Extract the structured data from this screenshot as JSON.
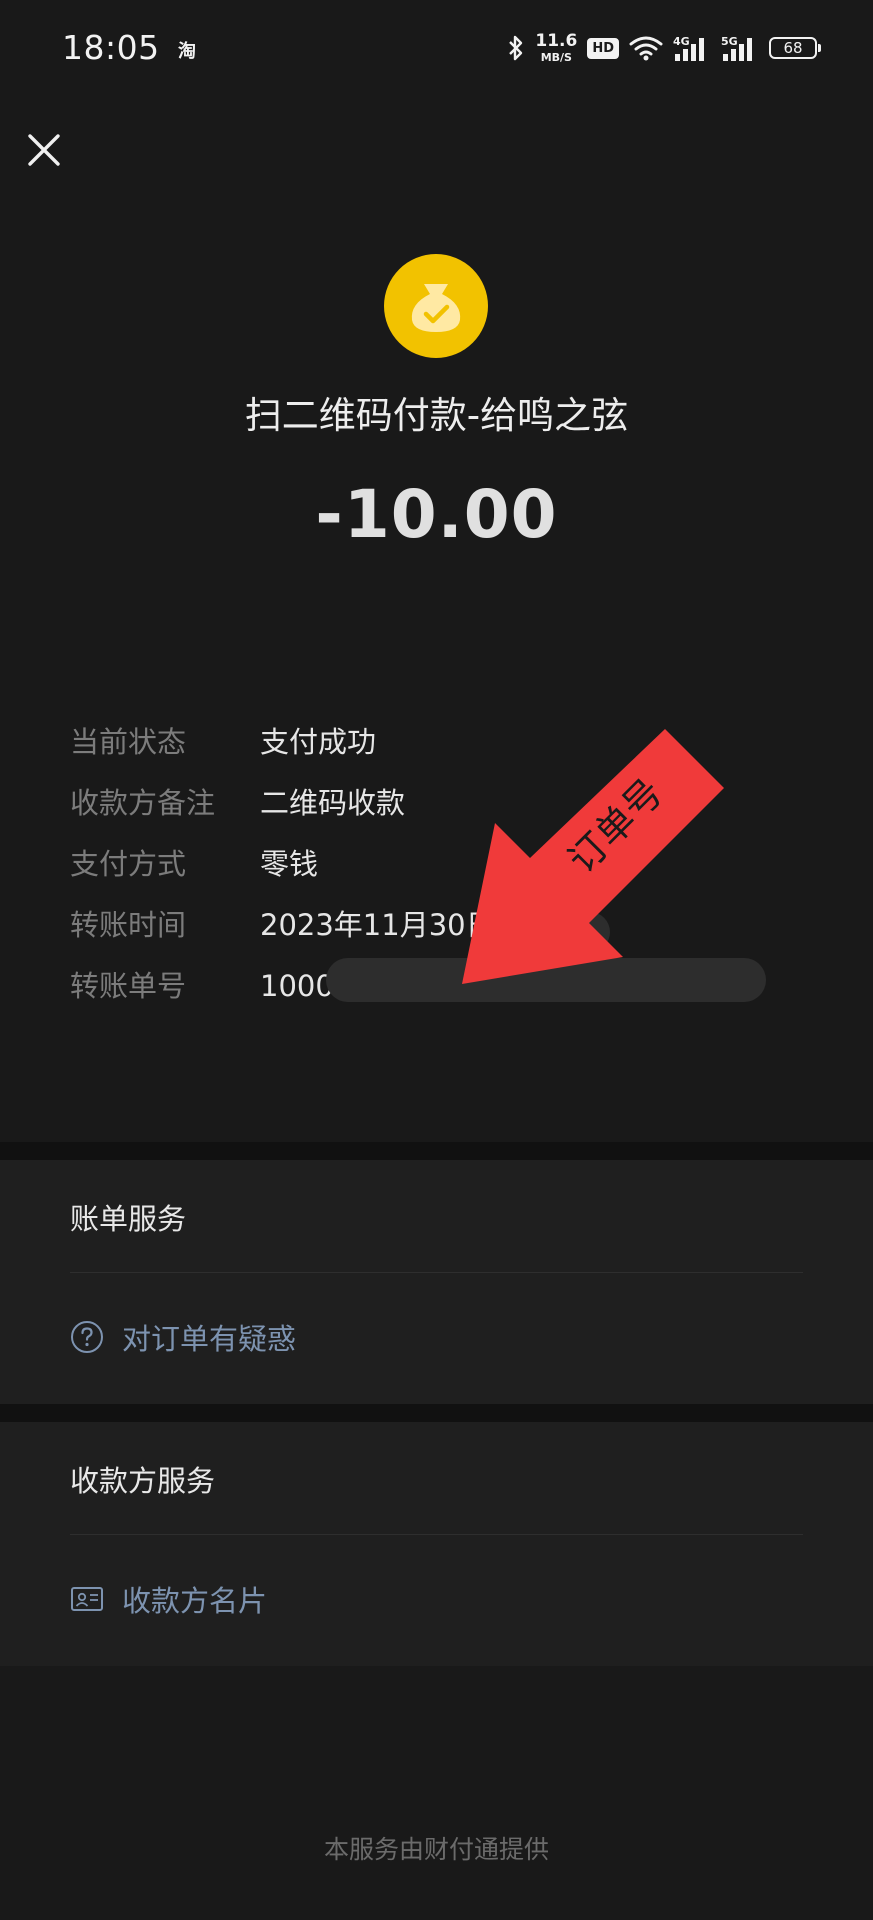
{
  "status_bar": {
    "time": "18:05",
    "app_indicator": "淘",
    "net_speed_value": "11.6",
    "net_speed_unit": "MB/S",
    "hd_badge": "HD",
    "battery": "68",
    "icons": [
      "bluetooth-icon",
      "wifi-icon",
      "signal-4g-icon",
      "signal-5g-icon"
    ]
  },
  "header": {
    "close_icon": "close-icon"
  },
  "transaction": {
    "icon": "money-bag-check-icon",
    "icon_color": "#f2c200",
    "title": "扫二维码付款-给鸣之弦",
    "amount": "-10.00"
  },
  "details": [
    {
      "label": "当前状态",
      "value": "支付成功"
    },
    {
      "label": "收款方备注",
      "value": "二维码收款"
    },
    {
      "label": "支付方式",
      "value": "零钱"
    },
    {
      "label": "转账时间",
      "value": "2023年11月30日"
    },
    {
      "label": "转账单号",
      "value": "1000                                                                              533"
    }
  ],
  "annotation": {
    "label": "订单号",
    "color": "#f03a3a"
  },
  "bill_service": {
    "heading": "账单服务",
    "link_icon": "question-circle-icon",
    "link_label": "对订单有疑惑"
  },
  "payee_service": {
    "heading": "收款方服务",
    "link_icon": "contact-card-icon",
    "link_label": "收款方名片"
  },
  "footer": {
    "text": "本服务由财付通提供"
  },
  "colors": {
    "background": "#191919",
    "section": "#1f1f1f",
    "link": "#7d93b0",
    "label": "#7c7c7c"
  }
}
